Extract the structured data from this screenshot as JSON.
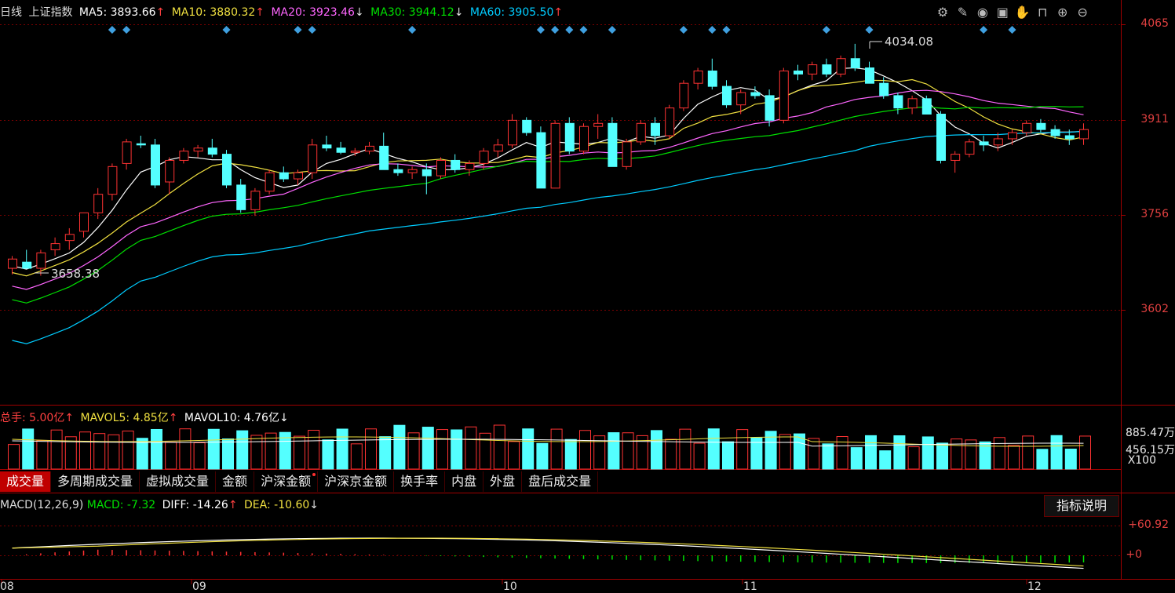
{
  "header": {
    "period": "日线",
    "index_name": "上证指数",
    "ma5": "MA5: 3893.66",
    "ma10": "MA10: 3880.32",
    "ma20": "MA20: 3923.46",
    "ma30": "MA30: 3944.12",
    "ma60": "MA60: 3905.50",
    "arrow_up": "↑",
    "arrow_down": "↓",
    "colors": {
      "ma5": "#ffffff",
      "ma10": "#f0e040",
      "ma20": "#ff66ff",
      "ma30": "#00e000",
      "ma60": "#00ccff"
    }
  },
  "toolbar_icons": [
    "settings-icon",
    "pen-icon",
    "eye-icon",
    "toolbox-icon",
    "hand-icon",
    "lock-icon",
    "zoom-in-icon",
    "zoom-out-icon"
  ],
  "price_axis": [
    "4065",
    "3911",
    "3756",
    "3602"
  ],
  "annotations": {
    "high": "4034.08",
    "low": "3658.38"
  },
  "volume": {
    "total": "总手: 5.00亿",
    "mavol5": "MAVOL5: 4.85亿",
    "mavol10": "MAVOL10: 4.76亿",
    "axis_top": "885.47万",
    "axis_mid": "456.15万",
    "axis_unit": "X100"
  },
  "tabs": [
    {
      "label": "成交量",
      "active": true
    },
    {
      "label": "多周期成交量",
      "active": false
    },
    {
      "label": "虚拟成交量",
      "active": false
    },
    {
      "label": "金额",
      "active": false
    },
    {
      "label": "沪深金额",
      "active": false,
      "dot": true
    },
    {
      "label": "沪深京金额",
      "active": false
    },
    {
      "label": "换手率",
      "active": false
    },
    {
      "label": "内盘",
      "active": false
    },
    {
      "label": "外盘",
      "active": false
    },
    {
      "label": "盘后成交量",
      "active": false
    }
  ],
  "macd": {
    "title": "MACD(12,26,9)",
    "macd": "MACD: -7.32",
    "diff": "DIFF: -14.26",
    "dea": "DEA: -10.60",
    "help_button": "指标说明",
    "axis_top": "+60.92",
    "axis_zero": "+0"
  },
  "dates": [
    "08",
    "09",
    "10",
    "11",
    "12"
  ],
  "chart_data": {
    "type": "candlestick",
    "ylim": [
      3560,
      4090
    ],
    "candles": [
      [
        3670,
        3690,
        3660,
        3685
      ],
      [
        3680,
        3700,
        3670,
        3670
      ],
      [
        3670,
        3700,
        3658,
        3695
      ],
      [
        3700,
        3720,
        3690,
        3710
      ],
      [
        3715,
        3735,
        3700,
        3725
      ],
      [
        3730,
        3760,
        3720,
        3760
      ],
      [
        3760,
        3800,
        3750,
        3790
      ],
      [
        3790,
        3840,
        3780,
        3835
      ],
      [
        3840,
        3880,
        3830,
        3875
      ],
      [
        3872,
        3885,
        3865,
        3870
      ],
      [
        3870,
        3880,
        3800,
        3805
      ],
      [
        3810,
        3850,
        3790,
        3845
      ],
      [
        3845,
        3865,
        3840,
        3860
      ],
      [
        3860,
        3870,
        3850,
        3865
      ],
      [
        3865,
        3880,
        3850,
        3855
      ],
      [
        3855,
        3862,
        3800,
        3805
      ],
      [
        3805,
        3815,
        3760,
        3765
      ],
      [
        3765,
        3800,
        3755,
        3795
      ],
      [
        3795,
        3830,
        3790,
        3825
      ],
      [
        3825,
        3835,
        3810,
        3815
      ],
      [
        3815,
        3830,
        3805,
        3825
      ],
      [
        3825,
        3880,
        3815,
        3870
      ],
      [
        3870,
        3885,
        3860,
        3865
      ],
      [
        3865,
        3875,
        3855,
        3858
      ],
      [
        3858,
        3865,
        3852,
        3860
      ],
      [
        3860,
        3875,
        3855,
        3868
      ],
      [
        3868,
        3890,
        3830,
        3830
      ],
      [
        3830,
        3840,
        3820,
        3825
      ],
      [
        3825,
        3835,
        3815,
        3830
      ],
      [
        3830,
        3840,
        3790,
        3820
      ],
      [
        3820,
        3850,
        3815,
        3845
      ],
      [
        3845,
        3855,
        3825,
        3830
      ],
      [
        3830,
        3845,
        3820,
        3840
      ],
      [
        3840,
        3865,
        3830,
        3860
      ],
      [
        3860,
        3880,
        3850,
        3870
      ],
      [
        3870,
        3920,
        3865,
        3910
      ],
      [
        3910,
        3915,
        3885,
        3890
      ],
      [
        3890,
        3900,
        3800,
        3800
      ],
      [
        3800,
        3910,
        3800,
        3905
      ],
      [
        3905,
        3915,
        3855,
        3860
      ],
      [
        3860,
        3905,
        3855,
        3900
      ],
      [
        3900,
        3920,
        3880,
        3905
      ],
      [
        3905,
        3915,
        3835,
        3835
      ],
      [
        3835,
        3880,
        3830,
        3875
      ],
      [
        3875,
        3910,
        3870,
        3905
      ],
      [
        3905,
        3915,
        3870,
        3885
      ],
      [
        3885,
        3935,
        3880,
        3930
      ],
      [
        3930,
        3975,
        3925,
        3970
      ],
      [
        3970,
        3995,
        3960,
        3990
      ],
      [
        3990,
        4010,
        3960,
        3965
      ],
      [
        3965,
        3975,
        3930,
        3935
      ],
      [
        3935,
        3960,
        3920,
        3955
      ],
      [
        3955,
        3965,
        3945,
        3950
      ],
      [
        3950,
        3960,
        3900,
        3910
      ],
      [
        3910,
        3995,
        3905,
        3990
      ],
      [
        3990,
        4000,
        3975,
        3985
      ],
      [
        3985,
        4005,
        3975,
        4000
      ],
      [
        4000,
        4010,
        3980,
        3985
      ],
      [
        3985,
        4015,
        3980,
        4010
      ],
      [
        4010,
        4034,
        3990,
        3995
      ],
      [
        3995,
        4005,
        3970,
        3970
      ],
      [
        3970,
        3980,
        3945,
        3950
      ],
      [
        3950,
        3955,
        3920,
        3930
      ],
      [
        3930,
        3950,
        3920,
        3945
      ],
      [
        3945,
        3950,
        3920,
        3920
      ],
      [
        3920,
        3925,
        3840,
        3845
      ],
      [
        3845,
        3860,
        3825,
        3855
      ],
      [
        3855,
        3880,
        3850,
        3875
      ],
      [
        3875,
        3885,
        3860,
        3870
      ],
      [
        3870,
        3890,
        3860,
        3880
      ],
      [
        3880,
        3895,
        3870,
        3890
      ],
      [
        3890,
        3910,
        3885,
        3905
      ],
      [
        3905,
        3912,
        3890,
        3895
      ],
      [
        3895,
        3902,
        3880,
        3885
      ],
      [
        3885,
        3895,
        3870,
        3880
      ],
      [
        3880,
        3905,
        3870,
        3895
      ]
    ]
  }
}
